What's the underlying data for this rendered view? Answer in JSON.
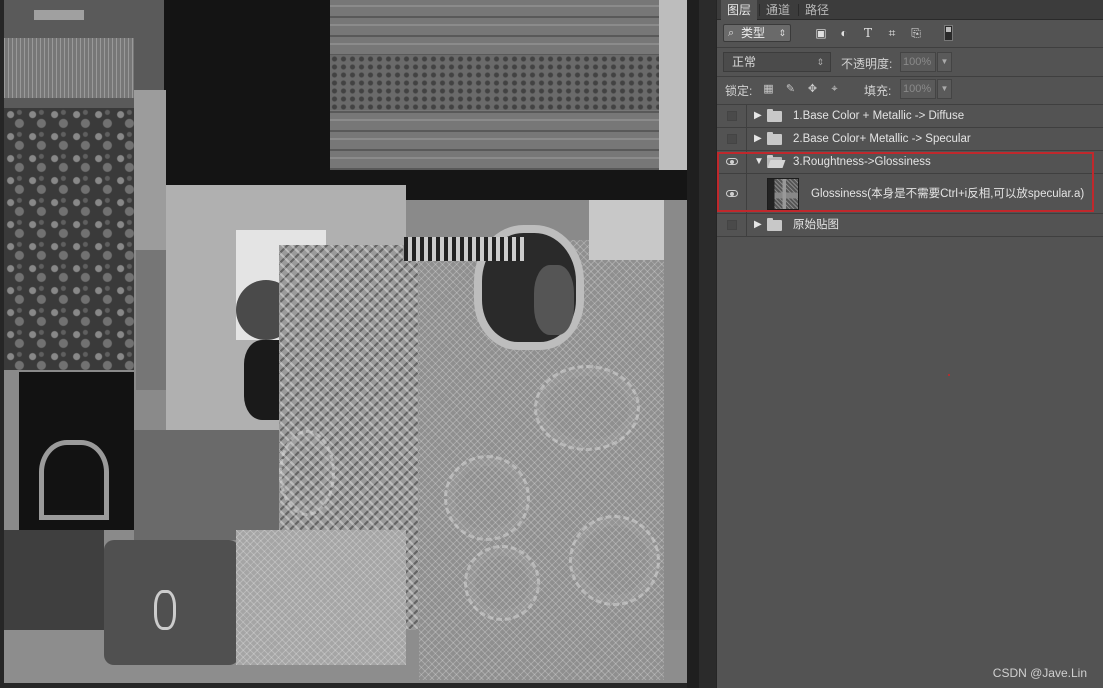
{
  "panel": {
    "tabs": [
      {
        "label": "图层",
        "active": true
      },
      {
        "label": "通道",
        "active": false
      },
      {
        "label": "路径",
        "active": false
      }
    ],
    "filter": {
      "label": "类型"
    },
    "blend_mode": "正常",
    "opacity_label": "不透明度:",
    "opacity_value": "100%",
    "lock_label": "锁定:",
    "fill_label": "填充:",
    "fill_value": "100%"
  },
  "layers": [
    {
      "name": "1.Base Color + Metallic -> Diffuse",
      "type": "group",
      "visible": false,
      "expanded": false
    },
    {
      "name": "2.Base Color+ Metallic -> Specular",
      "type": "group",
      "visible": false,
      "expanded": false
    },
    {
      "name": "3.Roughtness->Glossiness",
      "type": "group",
      "visible": true,
      "expanded": true
    },
    {
      "name": "Glossiness(本身是不需要Ctrl+i反相,可以放specular.a)",
      "type": "layer",
      "visible": true,
      "expanded": false
    },
    {
      "name": "原始贴图",
      "type": "group",
      "visible": false,
      "expanded": false
    }
  ],
  "watermark": "CSDN @Jave.Lin",
  "colors": {
    "panel_bg": "#535353",
    "highlight_border": "#c0282c",
    "canvas_bg": "#262626"
  }
}
